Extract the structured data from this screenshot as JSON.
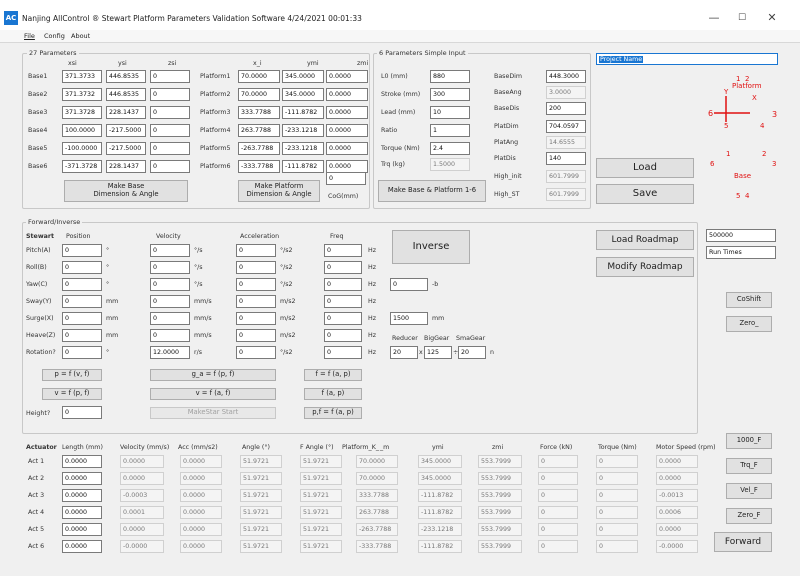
{
  "window": {
    "title": "Nanjing AllControl ® Stewart Platform Parameters Validation Software 4/24/2021 00:01:33",
    "icon_text": "AC",
    "minimize": "—",
    "maximize": "☐",
    "close": "✕"
  },
  "menu": [
    "File",
    "Config",
    "About"
  ],
  "params27": {
    "title": "27 Parameters",
    "headers": [
      "xsi",
      "ysi",
      "zsi",
      "x_i",
      "ymi",
      "zmi"
    ],
    "base_labels": [
      "Base1",
      "Base2",
      "Base3",
      "Base4",
      "Base5",
      "Base6"
    ],
    "plat_labels": [
      "Platform1",
      "Platform2",
      "Platform3",
      "Platform4",
      "Platform5",
      "Platform6"
    ],
    "base_rows": [
      [
        "371.3733",
        "446.8535",
        "0"
      ],
      [
        "371.3732",
        "446.8535",
        "0"
      ],
      [
        "371.3728",
        "228.1437",
        "0"
      ],
      [
        "100.0000",
        "-217.5000",
        "0"
      ],
      [
        "-100.0000",
        "-217.5000",
        "0"
      ],
      [
        "-371.3728",
        "228.1437",
        "0"
      ]
    ],
    "plat_rows": [
      [
        "70.0000",
        "345.0000",
        "0.0000"
      ],
      [
        "70.0000",
        "345.0000",
        "0.0000"
      ],
      [
        "333.7788",
        "-111.8782",
        "0.0000"
      ],
      [
        "263.7788",
        "-233.1218",
        "0.0000"
      ],
      [
        "-263.7788",
        "-233.1218",
        "0.0000"
      ],
      [
        "-333.7788",
        "-111.8782",
        "0.0000"
      ]
    ],
    "make_base_btn": "Make Base\nDimension & Angle",
    "make_plat_btn": "Make Platform\nDimension & Angle",
    "cog_value": "0",
    "cog_label": "CoG(mm)"
  },
  "simple": {
    "title": "6 Parameters Simple Input",
    "left_labels": [
      "L0 (mm)",
      "Stroke (mm)",
      "Lead (mm)",
      "Ratio",
      "Torque (Nm)",
      "Trq (kg)"
    ],
    "left_values": [
      "880",
      "300",
      "10",
      "1",
      "2.4",
      "1.5000"
    ],
    "left_readonly": [
      false,
      false,
      false,
      false,
      false,
      true
    ],
    "right_labels": [
      "BaseDim",
      "BaseAng",
      "BaseDis",
      "PlatDim",
      "PlatAng",
      "PlatDis",
      "High_init",
      "High_ST"
    ],
    "right_values": [
      "448.3000",
      "3.0000",
      "200",
      "704.0597",
      "14.6555",
      "140",
      "601.7999",
      "601.7999"
    ],
    "right_readonly": [
      false,
      true,
      false,
      false,
      true,
      false,
      true,
      true
    ],
    "make_btn": "Make Base & Platform 1-6"
  },
  "project": {
    "placeholder": "Project Name"
  },
  "diagram": {
    "platform_label": "Platform",
    "base_label": "Base",
    "axis_x": "X",
    "axis_y": "Y",
    "plat_nums": [
      "1",
      "2",
      "3",
      "5",
      "4",
      "1",
      "6"
    ],
    "base_nums": [
      "1",
      "2",
      "6",
      "3",
      "5",
      "4"
    ]
  },
  "load_btn": "Load",
  "save_btn": "Save",
  "fi": {
    "title": "Forward/Inverse",
    "row_header": "Stewart",
    "col_headers": [
      "Position",
      "Velocity",
      "Acceleration",
      "Freq"
    ],
    "rows": [
      {
        "label": "Pitch(A)",
        "pos": "0",
        "pu": "°",
        "vel": "0",
        "vu": "°/s",
        "acc": "0",
        "au": "°/s2",
        "freq": "0",
        "fu": "Hz"
      },
      {
        "label": "Roll(B)",
        "pos": "0",
        "pu": "°",
        "vel": "0",
        "vu": "°/s",
        "acc": "0",
        "au": "°/s2",
        "freq": "0",
        "fu": "Hz"
      },
      {
        "label": "Yaw(C)",
        "pos": "0",
        "pu": "°",
        "vel": "0",
        "vu": "°/s",
        "acc": "0",
        "au": "°/s2",
        "freq": "0",
        "fu": "Hz"
      },
      {
        "label": "Sway(Y)",
        "pos": "0",
        "pu": "mm",
        "vel": "0",
        "vu": "mm/s",
        "acc": "0",
        "au": "m/s2",
        "freq": "0",
        "fu": "Hz"
      },
      {
        "label": "Surge(X)",
        "pos": "0",
        "pu": "mm",
        "vel": "0",
        "vu": "mm/s",
        "acc": "0",
        "au": "m/s2",
        "freq": "0",
        "fu": "Hz"
      },
      {
        "label": "Heave(Z)",
        "pos": "0",
        "pu": "mm",
        "vel": "0",
        "vu": "mm/s",
        "acc": "0",
        "au": "m/s2",
        "freq": "0",
        "fu": "Hz"
      },
      {
        "label": "Rotation?",
        "pos": "0",
        "pu": "°",
        "vel": "12.0000",
        "vu": "r/s",
        "acc": "0",
        "au": "°/s2",
        "freq": "0",
        "fu": "Hz"
      }
    ],
    "inverse_btn": "Inverse",
    "extra1_value": "0",
    "extra1_unit": "-b",
    "extra2_value": "1500",
    "extra2_unit": "mm",
    "reducer_labels": [
      "Reducer",
      "BigGear",
      "SmaGear"
    ],
    "reducer_values": [
      "20",
      "125",
      "20"
    ],
    "reducer_ops": [
      "x",
      "÷"
    ],
    "reducer_unit": "n",
    "row_a": [
      "p = f (v, f)",
      "g_a = f (p, f)",
      "f = f (a, p)"
    ],
    "row_b": [
      "v = f (p, f)",
      "v = f (a, f)",
      "f (a, p)"
    ],
    "row_c": [
      "MakeStar Start",
      "p,f = f (a, p)"
    ],
    "height_label": "Height?",
    "height_value": "0",
    "load_roadmap": "Load Roadmap",
    "modify_roadmap": "Modify Roadmap",
    "roadmap_value": "500000",
    "run_times": "Run Times",
    "coshift": "CoShift",
    "zero": "Zero_"
  },
  "act": {
    "headers": [
      "Actuator",
      "Length (mm)",
      "Velocity (mm/s)",
      "Acc (mm/s2)",
      "Angle (°)",
      "F Angle (°)",
      "Platform_K_",
      "_m",
      "ymi",
      "zmi",
      "Force (kN)",
      "Torque (Nm)",
      "Motor Speed (rpm)"
    ],
    "rows": [
      {
        "label": "Act 1",
        "len": "0.0000",
        "vel": "0.0000",
        "acc": "0.0000",
        "ang": "51.9721",
        "fang": "51.9721",
        "xm": "70.0000",
        "ym": "345.0000",
        "zm": "553.7999",
        "force": "0",
        "torque": "0",
        "rpm": "0.0000"
      },
      {
        "label": "Act 2",
        "len": "0.0000",
        "vel": "0.0000",
        "acc": "0.0000",
        "ang": "51.9721",
        "fang": "51.9721",
        "xm": "70.0000",
        "ym": "345.0000",
        "zm": "553.7999",
        "force": "0",
        "torque": "0",
        "rpm": "0.0000"
      },
      {
        "label": "Act 3",
        "len": "0.0000",
        "vel": "-0.0003",
        "acc": "0.0000",
        "ang": "51.9721",
        "fang": "51.9721",
        "xm": "333.7788",
        "ym": "-111.8782",
        "zm": "553.7999",
        "force": "0",
        "torque": "0",
        "rpm": "-0.0013"
      },
      {
        "label": "Act 4",
        "len": "0.0000",
        "vel": "0.0001",
        "acc": "0.0000",
        "ang": "51.9721",
        "fang": "51.9721",
        "xm": "263.7788",
        "ym": "-111.8782",
        "zm": "553.7999",
        "force": "0",
        "torque": "0",
        "rpm": "0.0006"
      },
      {
        "label": "Act 5",
        "len": "0.0000",
        "vel": "0.0000",
        "acc": "0.0000",
        "ang": "51.9721",
        "fang": "51.9721",
        "xm": "-263.7788",
        "ym": "-233.1218",
        "zm": "553.7999",
        "force": "0",
        "torque": "0",
        "rpm": "0.0000"
      },
      {
        "label": "Act 6",
        "len": "0.0000",
        "vel": "-0.0000",
        "acc": "0.0000",
        "ang": "51.9721",
        "fang": "51.9721",
        "xm": "-333.7788",
        "ym": "-111.8782",
        "zm": "553.7999",
        "force": "0",
        "torque": "0",
        "rpm": "-0.0000"
      }
    ],
    "side_btns": [
      "1000_F",
      "Trq_F",
      "Vel_F",
      "Zero_F"
    ],
    "forward_btn": "Forward"
  },
  "colors": {
    "accent": "#1976d2",
    "diagram_red": "#e01010"
  }
}
